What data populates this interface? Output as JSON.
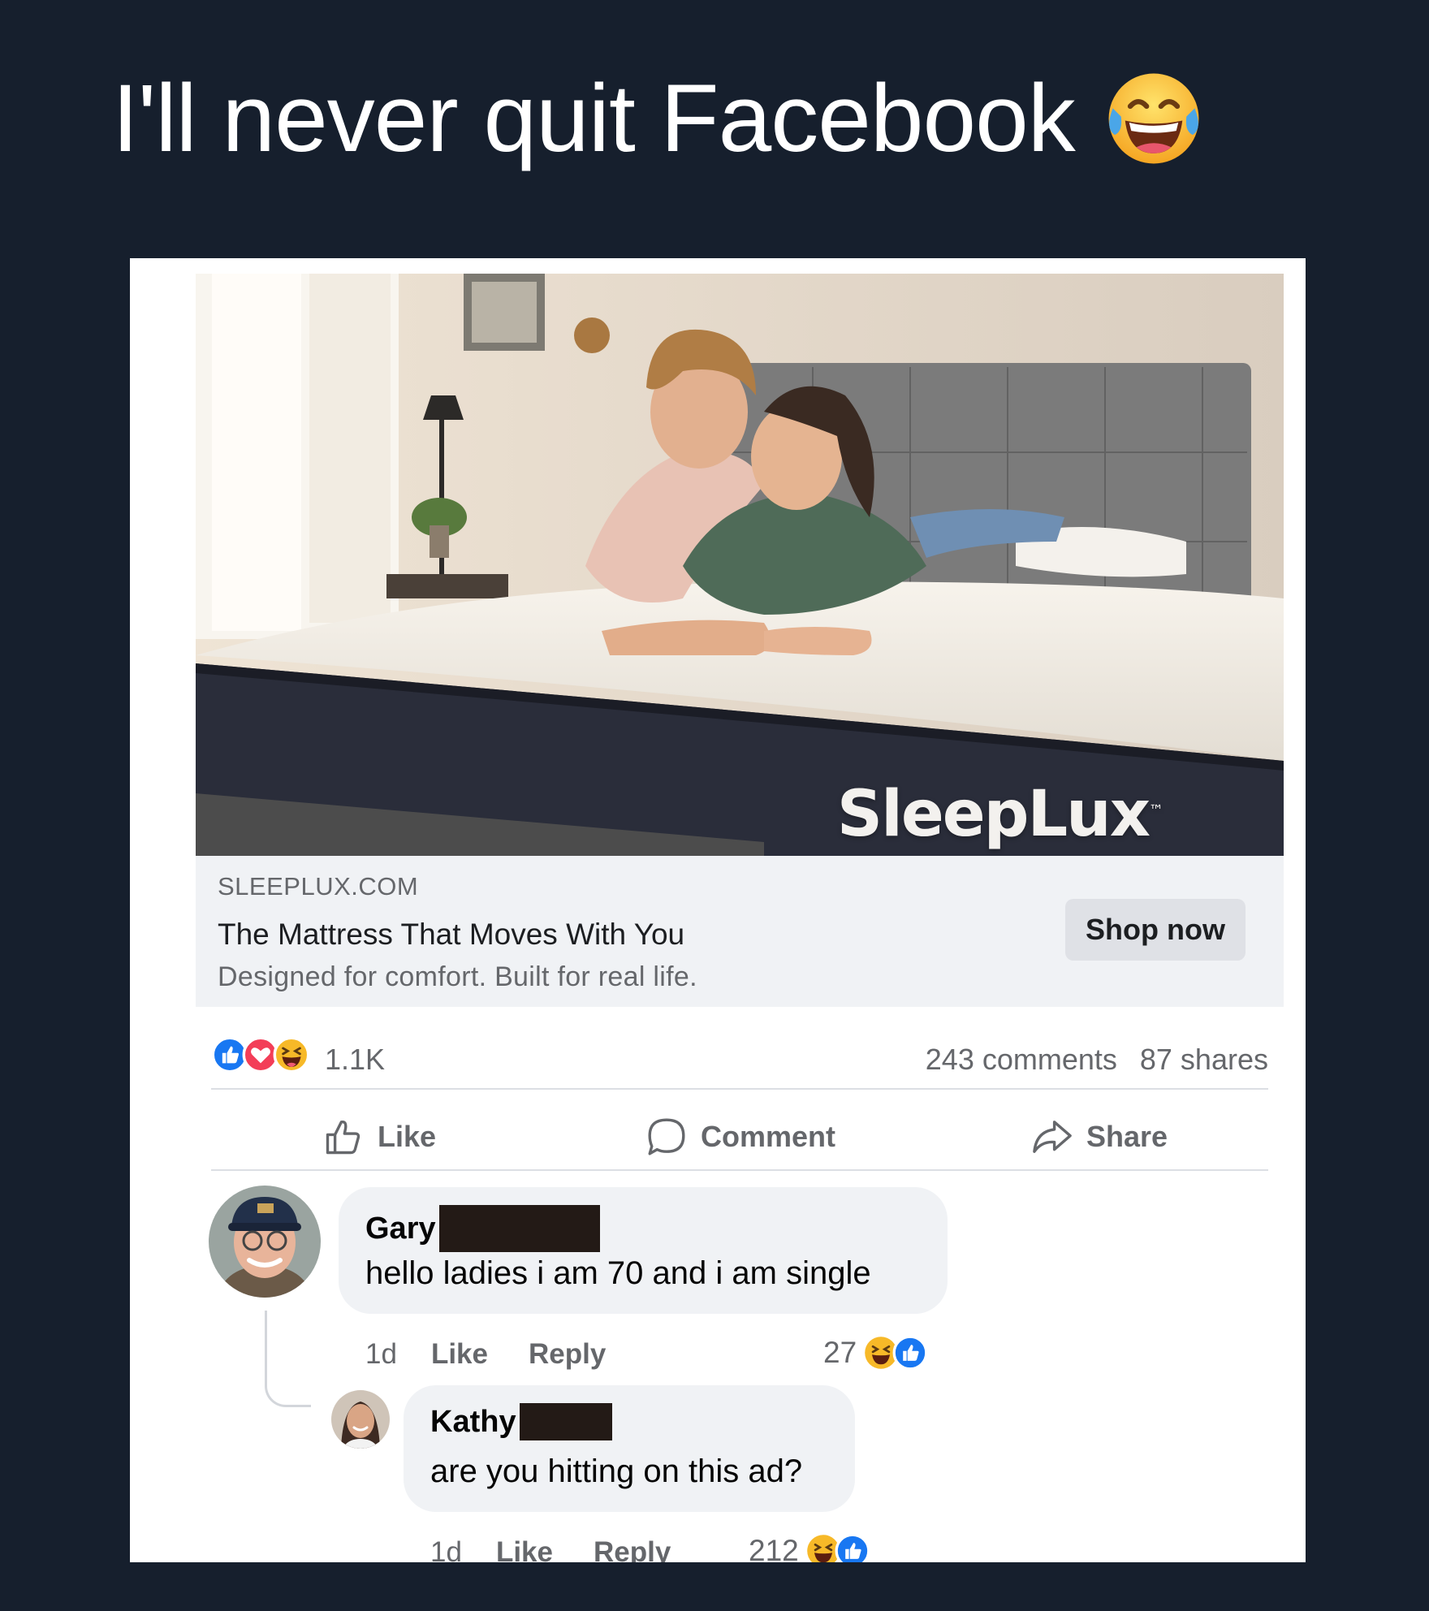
{
  "caption": {
    "text": "I'll never quit Facebook",
    "emoji_icon": "tears-of-joy-emoji-icon"
  },
  "ad": {
    "brand_logo": "SleepLux",
    "domain": "SLEEPLUX.COM",
    "headline": "The Mattress That Moves With You",
    "description": "Designed for comfort. Built for real life.",
    "cta_label": "Shop now"
  },
  "stats": {
    "reaction_icons": [
      "like-reaction-icon",
      "love-reaction-icon",
      "haha-reaction-icon"
    ],
    "reaction_count": "1.1K",
    "comments": "243 comments",
    "shares": "87 shares"
  },
  "actions": {
    "like": "Like",
    "comment": "Comment",
    "share": "Share"
  },
  "comments": [
    {
      "name": "Gary",
      "text": "hello ladies i am 70 and i am single",
      "time": "1d",
      "like_label": "Like",
      "reply_label": "Reply",
      "reaction_count": "27"
    },
    {
      "name": "Kathy",
      "text": "are you hitting on this ad?",
      "time": "1d",
      "like_label": "Like",
      "reply_label": "Reply",
      "reaction_count": "212"
    }
  ],
  "colors": {
    "background": "#161f2d",
    "facebook_blue": "#1877f2",
    "love_red": "#f33e58",
    "haha_yellow": "#f7b928",
    "muted_text": "#65676b"
  }
}
